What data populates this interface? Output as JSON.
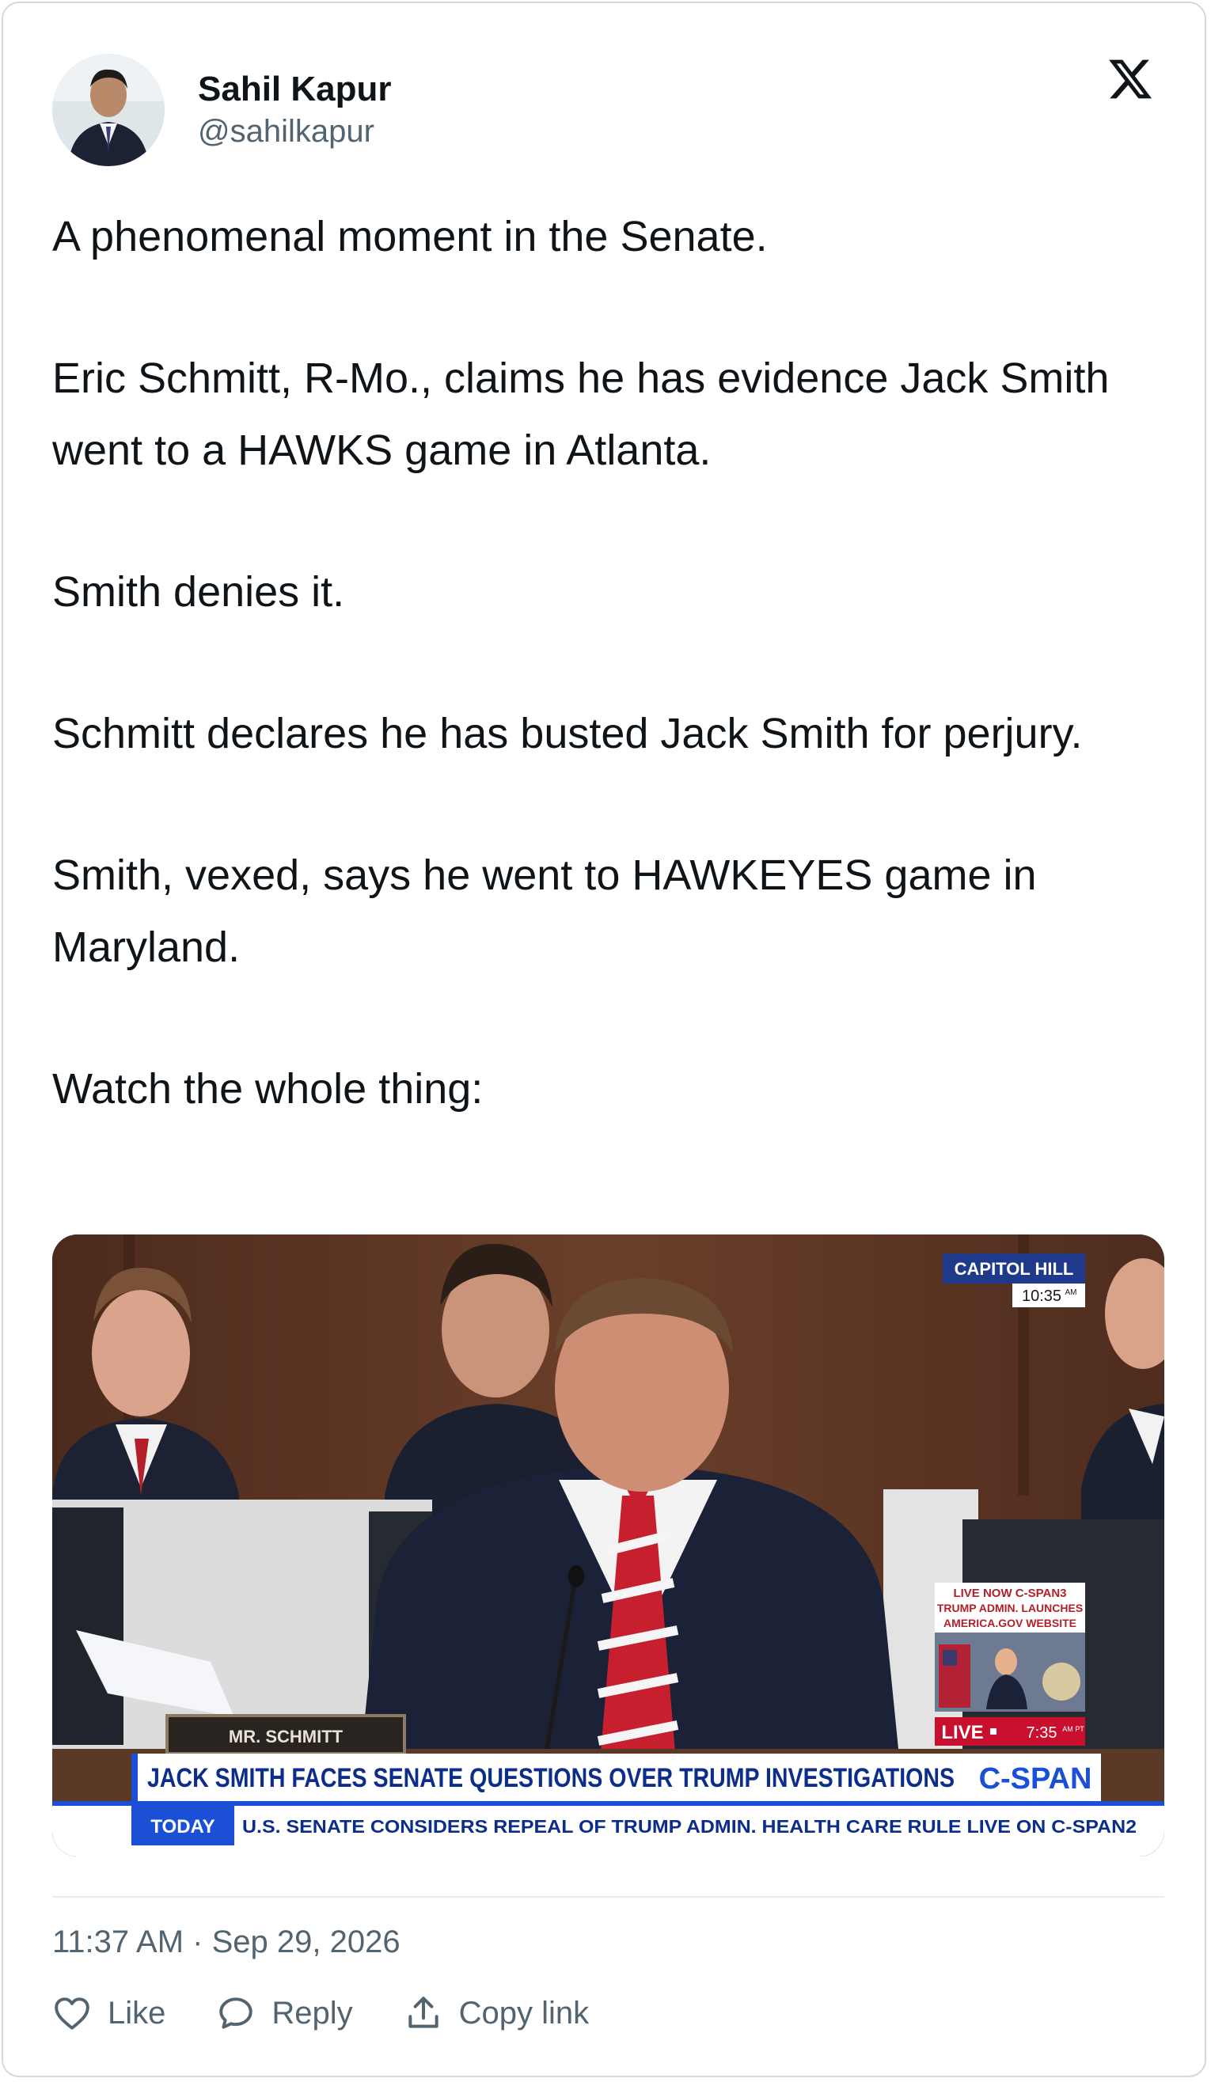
{
  "author": {
    "name": "Sahil Kapur",
    "handle": "@sahilkapur"
  },
  "tweet": {
    "paragraphs": [
      "A phenomenal moment in the Senate.",
      "Eric Schmitt, R-Mo., claims he has evidence Jack Smith went to a HAWKS game in Atlanta.",
      "Smith denies it.",
      "Schmitt declares he has busted Jack Smith for perjury.",
      "Smith, vexed, says he went to HAWKEYES game in Maryland.",
      "Watch the whole thing:"
    ],
    "timestamp": "11:37 AM · Sep 29, 2026"
  },
  "media": {
    "location_bug": "CAPITOL HILL",
    "location_time": "10:35",
    "location_time_suffix": "AM",
    "nameplate": "MR. SCHMITT",
    "pip_lines": [
      "LIVE NOW C-SPAN3",
      "TRUMP ADMIN. LAUNCHES",
      "AMERICA.GOV WEBSITE"
    ],
    "live_label": "LIVE",
    "live_time": "7:35",
    "live_time_suffix": "AM PT",
    "chyron": "JACK SMITH FACES SENATE QUESTIONS OVER TRUMP INVESTIGATIONS",
    "network": "C-SPAN",
    "ticker_label": "TODAY",
    "ticker_text": "U.S. SENATE CONSIDERS REPEAL OF TRUMP ADMIN. HEALTH CARE RULE  LIVE ON C-SPAN2"
  },
  "actions": {
    "like": "Like",
    "reply": "Reply",
    "copy": "Copy link"
  },
  "icons": {
    "brand": "x-logo-icon",
    "like": "heart-icon",
    "reply": "speech-bubble-icon",
    "copy": "share-upload-icon"
  },
  "colors": {
    "text": "#0f1419",
    "secondary": "#536471",
    "border": "#cfd9de",
    "cspan_blue": "#1a4fd6"
  }
}
